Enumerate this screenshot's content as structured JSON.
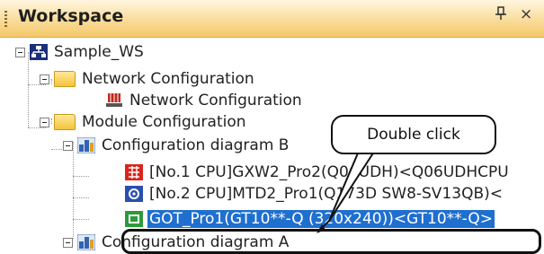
{
  "panel": {
    "title": "Workspace",
    "pin_glyph": "p",
    "close_glyph": "×"
  },
  "tree": [
    {
      "label": "Sample_WS",
      "icon": "workspace-icon"
    },
    {
      "label": "Network Configuration",
      "icon": "folder-icon"
    },
    {
      "label": "Network Configuration",
      "icon": "network-config-icon"
    },
    {
      "label": "Module Configuration",
      "icon": "folder-icon"
    },
    {
      "label": "Configuration diagram B",
      "icon": "config-diagram-icon"
    },
    {
      "label": "[No.1 CPU]GXW2_Pro2(Q06UDH)<Q06UDHCPU",
      "icon": "cpu-project-icon"
    },
    {
      "label": "[No.2 CPU]MTD2_Pro1(Q173D SW8-SV13QB)<",
      "icon": "motion-project-icon"
    },
    {
      "label": "GOT_Pro1(GT10**-Q (320x240))<GT10**-Q>",
      "icon": "got-project-icon",
      "selected": true
    },
    {
      "label": "Configuration diagram A",
      "icon": "config-diagram-icon"
    }
  ],
  "annotation": {
    "text": "Double click"
  },
  "colors": {
    "selection": "#1f6fcf",
    "title_bar": "#f9dc9a"
  }
}
